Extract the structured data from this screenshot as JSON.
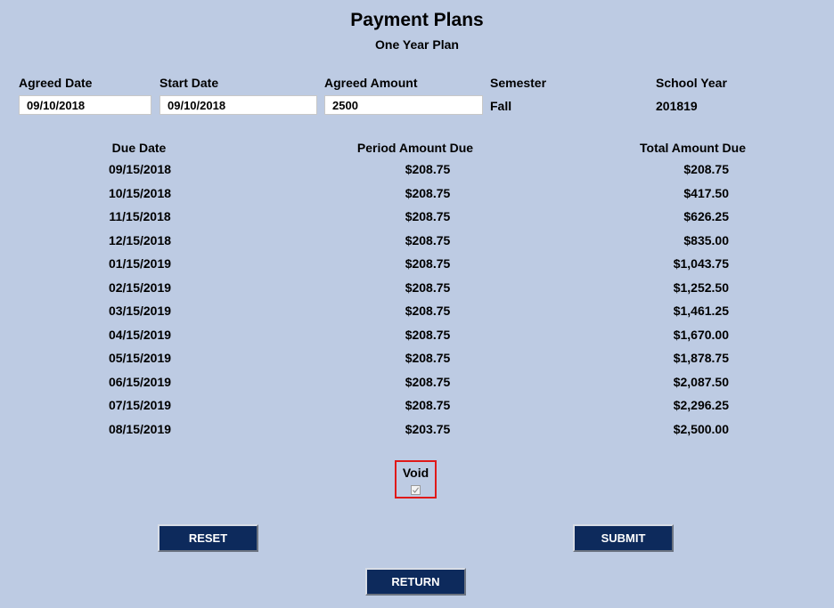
{
  "header": {
    "title": "Payment Plans",
    "subtitle": "One Year Plan"
  },
  "form": {
    "agreed_date_label": "Agreed Date",
    "agreed_date_value": "09/10/2018",
    "start_date_label": "Start Date",
    "start_date_value": "09/10/2018",
    "agreed_amount_label": "Agreed Amount",
    "agreed_amount_value": "2500",
    "semester_label": "Semester",
    "semester_value": "Fall",
    "school_year_label": "School Year",
    "school_year_value": "201819"
  },
  "schedule": {
    "columns": [
      "Due Date",
      "Period Amount Due",
      "Total Amount Due"
    ],
    "rows": [
      [
        "09/15/2018",
        "$208.75",
        "$208.75"
      ],
      [
        "10/15/2018",
        "$208.75",
        "$417.50"
      ],
      [
        "11/15/2018",
        "$208.75",
        "$626.25"
      ],
      [
        "12/15/2018",
        "$208.75",
        "$835.00"
      ],
      [
        "01/15/2019",
        "$208.75",
        "$1,043.75"
      ],
      [
        "02/15/2019",
        "$208.75",
        "$1,252.50"
      ],
      [
        "03/15/2019",
        "$208.75",
        "$1,461.25"
      ],
      [
        "04/15/2019",
        "$208.75",
        "$1,670.00"
      ],
      [
        "05/15/2019",
        "$208.75",
        "$1,878.75"
      ],
      [
        "06/15/2019",
        "$208.75",
        "$2,087.50"
      ],
      [
        "07/15/2019",
        "$208.75",
        "$2,296.25"
      ],
      [
        "08/15/2019",
        "$203.75",
        "$2,500.00"
      ]
    ]
  },
  "void": {
    "label": "Void",
    "checked": true,
    "highlight_color": "#e01919"
  },
  "buttons": {
    "reset_label": "RESET",
    "submit_label": "SUBMIT",
    "return_label": "RETURN"
  },
  "colors": {
    "background": "#bdcbe3",
    "button": "#0d2a5c"
  }
}
